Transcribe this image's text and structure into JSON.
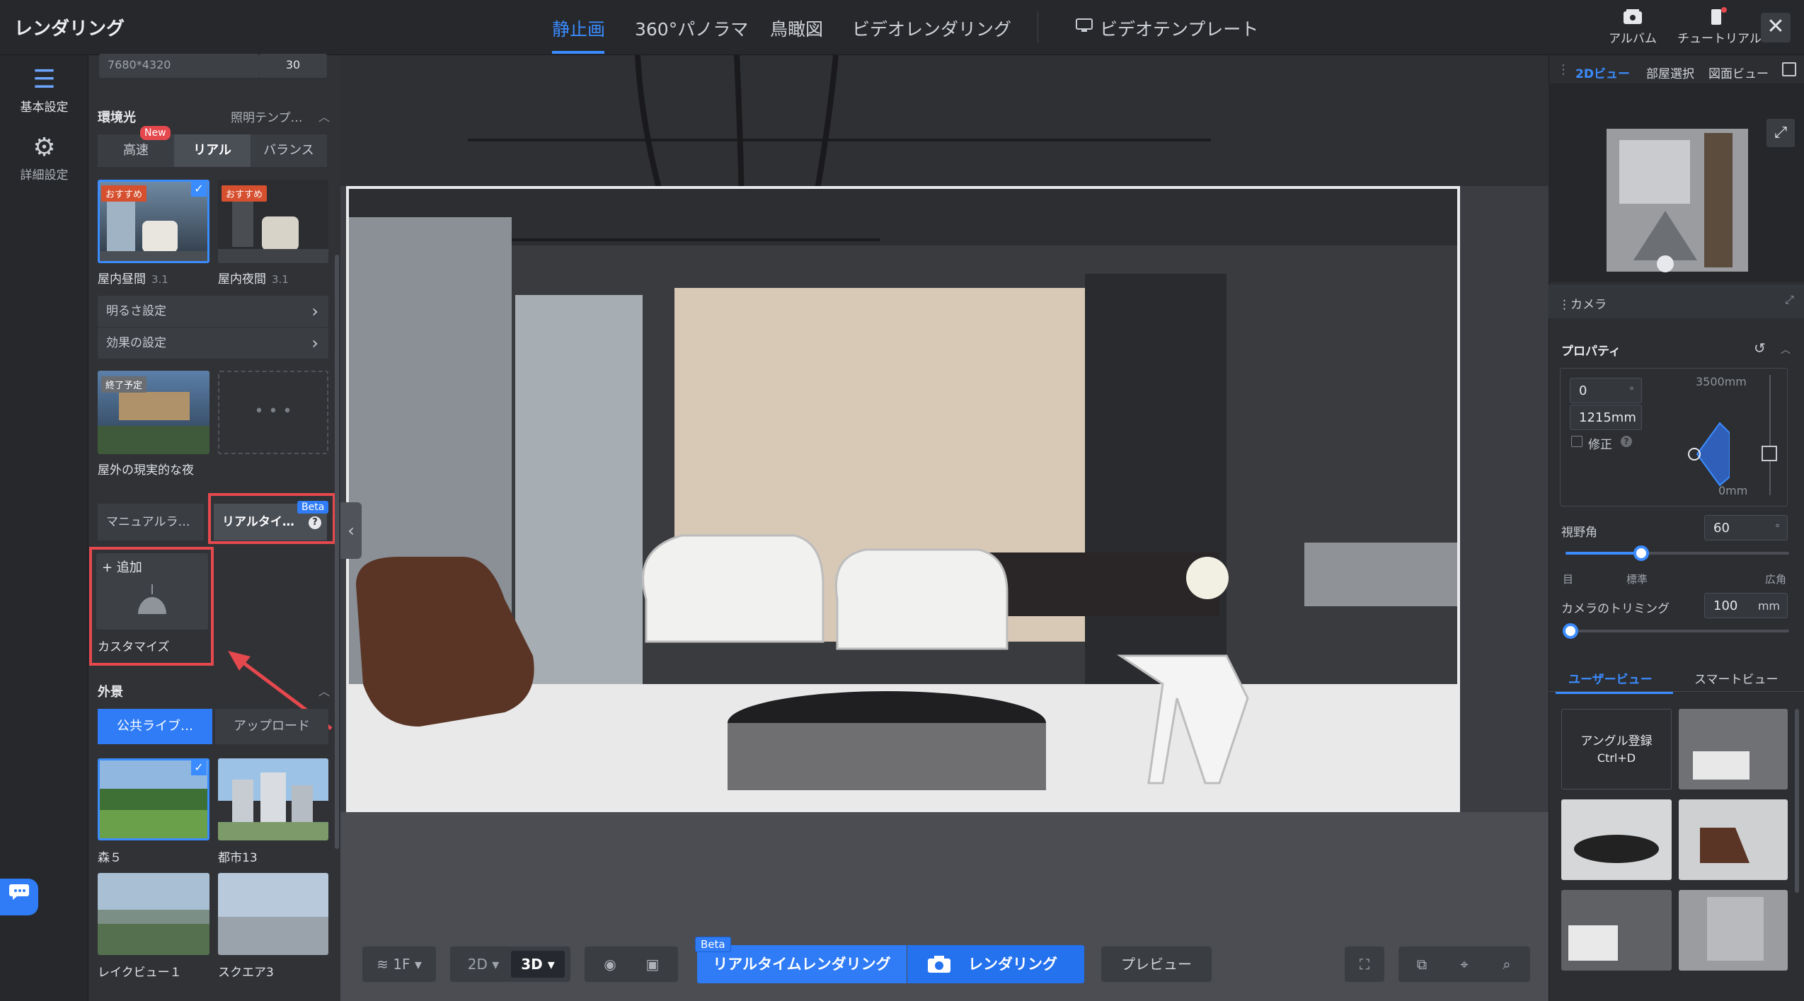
{
  "app": {
    "title": "レンダリング"
  },
  "modes": [
    "静止画",
    "360°パノラマ",
    "鳥瞰図",
    "ビデオレンダリング",
    "ビデオテンプレート"
  ],
  "top_right": {
    "album": "アルバム",
    "tutorial": "チュートリアル",
    "close": "✕"
  },
  "rail": {
    "basic": "基本設定",
    "advanced": "詳細設定"
  },
  "panel": {
    "resolution": "7680*4320",
    "resolution_value": "30",
    "ambient_title": "環境光",
    "lighting_template": "照明テンプ…",
    "new_badge": "New",
    "segments": [
      "高速",
      "リアル",
      "バランス"
    ],
    "recommend_badge": "おすすめ",
    "presets": [
      {
        "name": "屋内昼間",
        "ver": "3.1"
      },
      {
        "name": "屋内夜間",
        "ver": "3.1"
      }
    ],
    "brightness": "明るさ設定",
    "effects": "効果の設定",
    "ending_badge": "終了予定",
    "outdoor": "屋外の現実的な夜",
    "light_tabs": [
      "マニュアルラ…",
      "リアルタイ…"
    ],
    "beta_badge": "Beta",
    "help": "?",
    "add": "+ 追加",
    "customize": "カスタマイズ",
    "exterior_title": "外景",
    "ext_tabs": [
      "公共ライブ…",
      "アップロード"
    ],
    "scenes": [
      "森５",
      "都市13",
      "レイクビュー１",
      "スクエア3"
    ]
  },
  "bottom": {
    "floor": "1F ▾",
    "view2d": "2D ▾",
    "view3d": "3D ▾",
    "realtime": "リアルタイムレンダリング",
    "render": "レンダリング",
    "preview": "プレビュー",
    "beta": "Beta"
  },
  "right": {
    "tabs": [
      "2Dビュー",
      "部屋選択",
      "図面ビュー"
    ],
    "camera": "カメラ",
    "properties": "プロパティ",
    "angle": "0",
    "angle_unit": "°",
    "height": "1215mm",
    "fix": "修正",
    "top_mm": "3500mm",
    "bottom_mm": "0mm",
    "fov_label": "視野角",
    "fov_value": "60",
    "fov_unit": "°",
    "fov_marks": [
      "目",
      "標準",
      "広角"
    ],
    "fov_fraction": 0.34,
    "trim_label": "カメラのトリミング",
    "trim_value": "100",
    "trim_unit": "mm",
    "trim_fraction": 0.0,
    "view_tabs": [
      "ユーザービュー",
      "スマートビュー"
    ],
    "angle_reg": "アングル登録",
    "shortcut": "Ctrl+D"
  }
}
